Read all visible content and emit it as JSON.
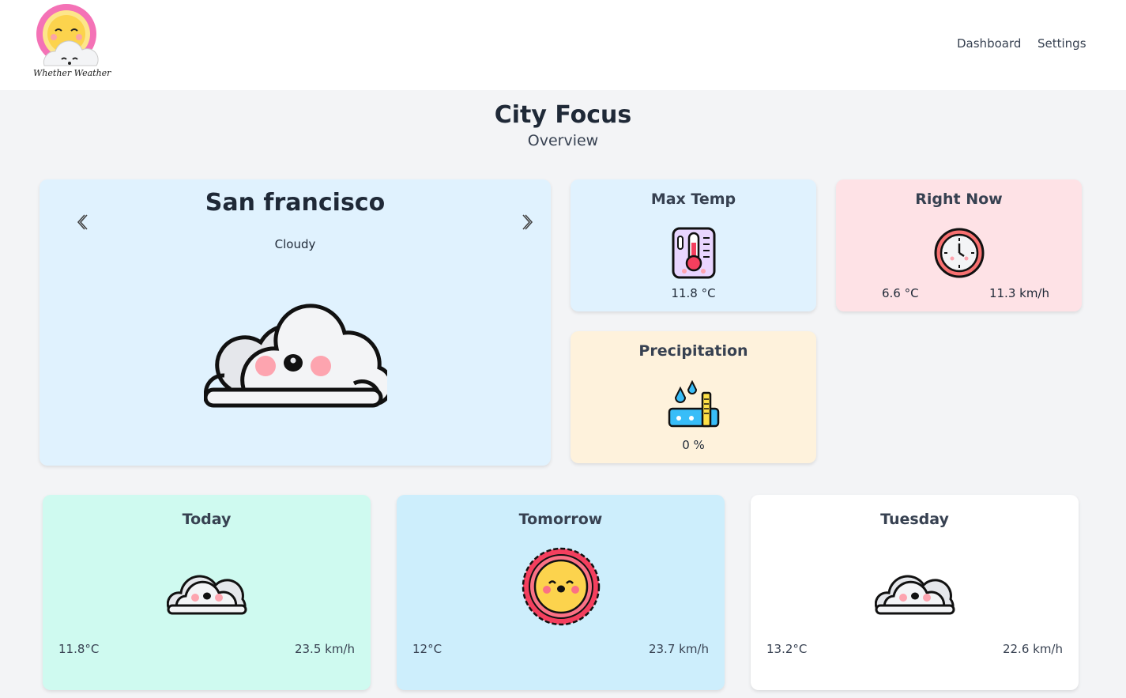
{
  "header": {
    "logo_text": "Whether Weather",
    "nav": {
      "dashboard": "Dashboard",
      "settings": "Settings"
    }
  },
  "page": {
    "title": "City Focus",
    "subtitle": "Overview"
  },
  "city": {
    "name": "San francisco",
    "condition": "Cloudy",
    "icon": "cloudy-icon"
  },
  "max_temp": {
    "title": "Max Temp",
    "value": "11.8 °C",
    "icon": "thermometer-icon"
  },
  "right_now": {
    "title": "Right Now",
    "temp": "6.6 °C",
    "wind": "11.3 km/h",
    "icon": "clock-icon"
  },
  "precipitation": {
    "title": "Precipitation",
    "value": "0 %",
    "icon": "rain-gauge-icon"
  },
  "forecast": [
    {
      "day": "Today",
      "temp": "11.8°C",
      "wind": "23.5 km/h",
      "icon": "cloudy-icon",
      "bg": "#cffaf0"
    },
    {
      "day": "Tomorrow",
      "temp": "12°C",
      "wind": "23.7 km/h",
      "icon": "sun-icon",
      "bg": "#cdeefc"
    },
    {
      "day": "Tuesday",
      "temp": "13.2°C",
      "wind": "22.6 km/h",
      "icon": "cloudy-icon",
      "bg": "#ffffff"
    }
  ],
  "colors": {
    "page_bg": "#f3f4f6",
    "main_card": "#e0f2fe",
    "right_now_card": "#fee2e6",
    "precip_card": "#fef2dc"
  }
}
